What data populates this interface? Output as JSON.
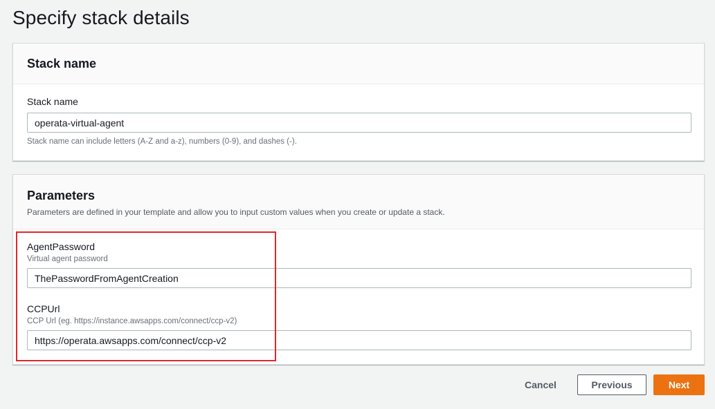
{
  "page": {
    "title": "Specify stack details"
  },
  "stack_name_panel": {
    "title": "Stack name",
    "field_label": "Stack name",
    "field_value": "operata-virtual-agent",
    "hint": "Stack name can include letters (A-Z and a-z), numbers (0-9), and dashes (-)."
  },
  "parameters_panel": {
    "title": "Parameters",
    "description": "Parameters are defined in your template and allow you to input custom values when you create or update a stack.",
    "params": [
      {
        "label": "AgentPassword",
        "sublabel": "Virtual agent password",
        "value": "ThePasswordFromAgentCreation"
      },
      {
        "label": "CCPUrl",
        "sublabel": "CCP Url (eg. https://instance.awsapps.com/connect/ccp-v2)",
        "value": "https://operata.awsapps.com/connect/ccp-v2"
      }
    ]
  },
  "footer": {
    "cancel_label": "Cancel",
    "previous_label": "Previous",
    "next_label": "Next"
  },
  "colors": {
    "accent": "#ec7211",
    "highlight_border": "#e0262b",
    "background": "#f2f3f3"
  }
}
